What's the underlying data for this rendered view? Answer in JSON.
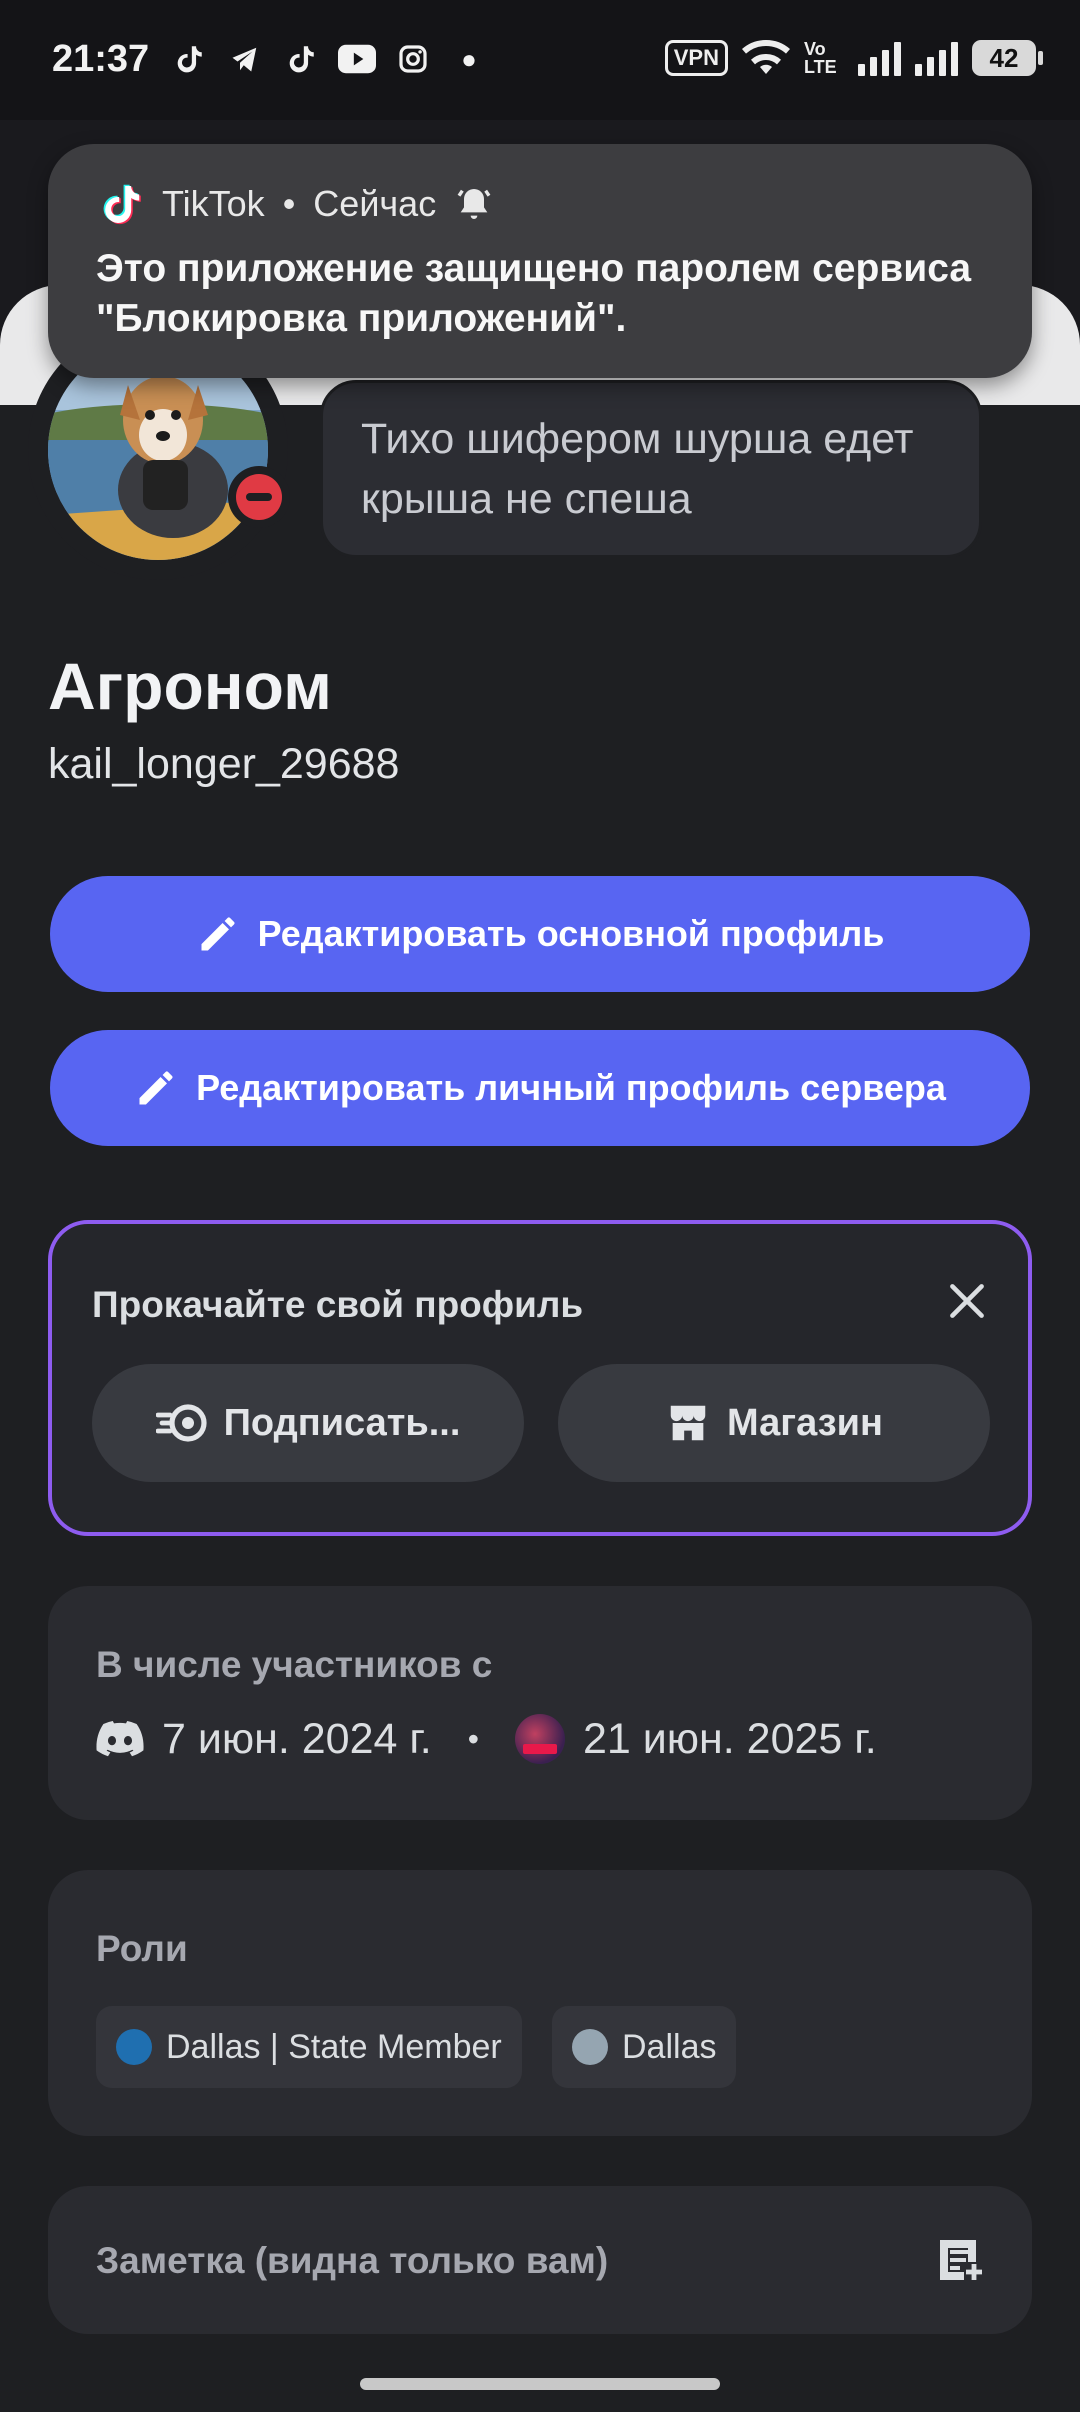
{
  "status_bar": {
    "time": "21:37",
    "vpn_label": "VPN",
    "network_label": "Vo LTE",
    "battery": "42"
  },
  "notification": {
    "app": "TikTok",
    "separator": "•",
    "time": "Сейчас",
    "text": "Это приложение защищено паролем сервиса \"Блокировка приложений\"."
  },
  "profile": {
    "status_message": "Тихо шифером шурша едет крыша не спеша",
    "display_name": "Агроном",
    "username": "kail_longer_29688",
    "status": "do-not-disturb"
  },
  "actions": {
    "edit_main": "Редактировать основной профиль",
    "edit_server": "Редактировать личный профиль сервера"
  },
  "upsell": {
    "title": "Прокачайте свой профиль",
    "subscribe": "Подписать...",
    "shop": "Магазин",
    "border_color": "#8e5cf0"
  },
  "member_since": {
    "label": "В числе участников с",
    "discord_date": "7 июн. 2024 г.",
    "separator": "•",
    "server_date": "21 июн. 2025 г."
  },
  "roles": {
    "label": "Роли",
    "items": [
      {
        "name": "Dallas | State Member",
        "color": "#1f6fb0"
      },
      {
        "name": "Dallas",
        "color": "#95a5b1"
      }
    ]
  },
  "note": {
    "placeholder": "Заметка (видна только вам)"
  },
  "colors": {
    "accent": "#5865f2",
    "dnd": "#e03a44"
  }
}
